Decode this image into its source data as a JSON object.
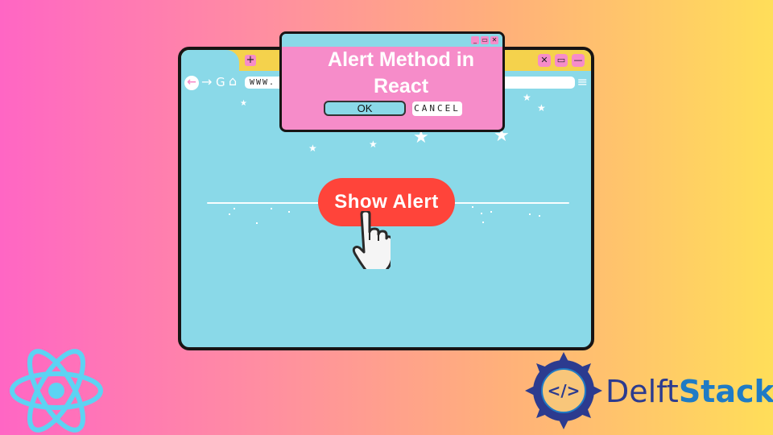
{
  "browser": {
    "url_text": "WWW.",
    "tab_new_label": "+",
    "window_buttons": [
      "close",
      "maximize",
      "minimize"
    ],
    "window_button_glyphs": [
      "✕",
      "▭",
      "—"
    ],
    "nav_icons": [
      "back-arrow-icon",
      "forward-arrow-icon",
      "reload-icon",
      "home-icon"
    ],
    "nav_glyphs": {
      "back": "←",
      "forward": "→",
      "reload": "G",
      "home": "⌂",
      "menu": "≡"
    }
  },
  "dialog": {
    "title": "Alert Method in React",
    "ok_label": "OK",
    "cancel_label": "CANCEL",
    "titlebar_glyphs": [
      "_",
      "▭",
      "✕"
    ]
  },
  "main": {
    "button_label": "Show Alert"
  },
  "branding": {
    "left_logo": "react-logo",
    "right_logo_part1": "Delft",
    "right_logo_part2": "Stack",
    "right_logo_icon_text": "</>"
  },
  "colors": {
    "background_gradient": [
      "#ff66c4",
      "#ffde59"
    ],
    "browser_body": "#8ad9e8",
    "tab_bar": "#f5d24c",
    "accent_pink": "#f68cc9",
    "button_red": "#ff443a",
    "react_blue": "#5dd3f3",
    "delft_dark": "#2c3b8f",
    "delft_light": "#1f7bc5"
  }
}
